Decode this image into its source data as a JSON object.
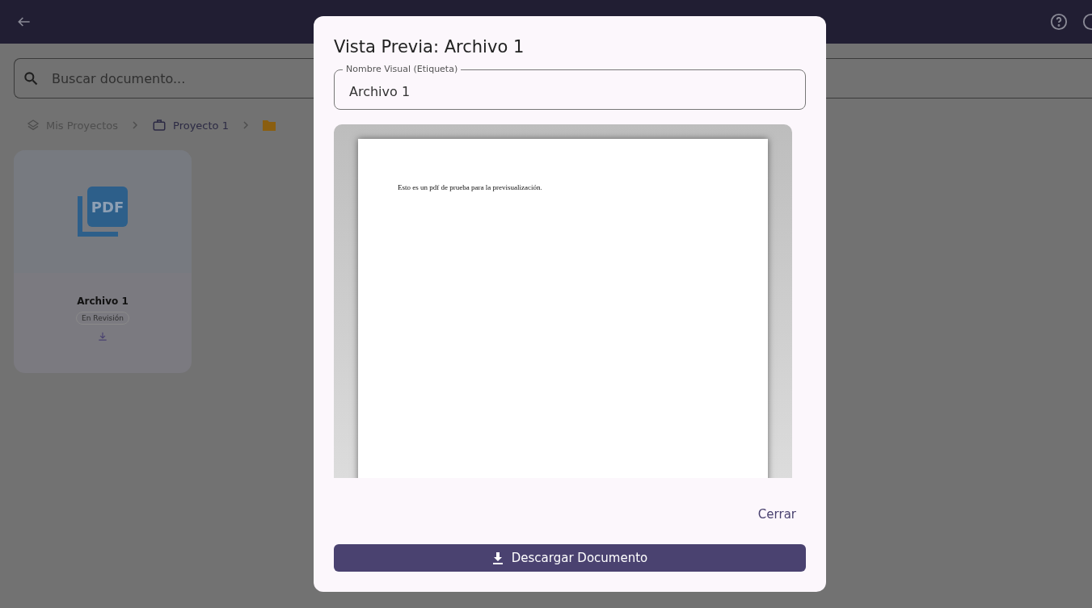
{
  "breadcrumb": [
    {
      "label": "Mis Proyectos",
      "kind": "layers"
    },
    {
      "label": "Proyecto 1",
      "kind": "briefcase"
    },
    {
      "kind": "folder"
    }
  ],
  "search": {
    "placeholder": "Buscar documento..."
  },
  "documents": [
    {
      "icon_text": "PDF",
      "name": "Archivo 1",
      "status": "En Revisión"
    }
  ],
  "dialog": {
    "title": "Vista Previa: Archivo 1",
    "field": {
      "label": "Nombre Visual (Etiqueta)",
      "value": "Archivo 1"
    },
    "pdf_text": "Esto es un pdf de prueba para la previsualización.",
    "close": "Cerrar",
    "download": "Descargar Documento"
  }
}
